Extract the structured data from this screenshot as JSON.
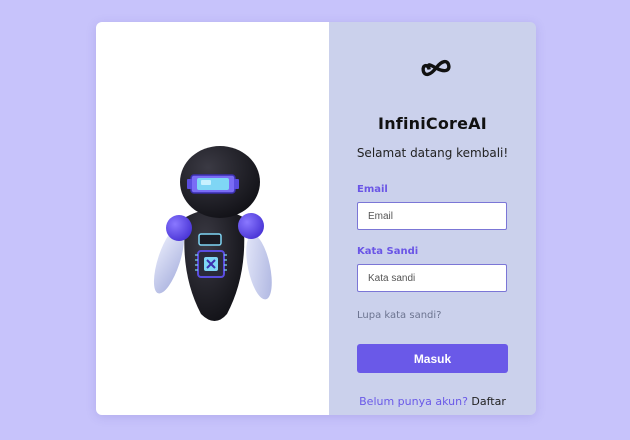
{
  "brand": {
    "name": "InfiniCoreAI",
    "logo_icon": "infinity-icon"
  },
  "hero": {
    "image": "robot-illustration"
  },
  "form": {
    "welcome": "Selamat datang kembali!",
    "email_label": "Email",
    "email_placeholder": "Email",
    "email_value": "",
    "password_label": "Kata Sandi",
    "password_placeholder": "Kata sandi",
    "password_value": "",
    "forgot": "Lupa kata sandi?",
    "submit": "Masuk",
    "signup_question": "Belum punya akun?",
    "signup_link": "Daftar"
  },
  "colors": {
    "background": "#c7c3fb",
    "panel": "#cbd1ec",
    "accent": "#6a59e8",
    "label": "#6a55e6"
  }
}
